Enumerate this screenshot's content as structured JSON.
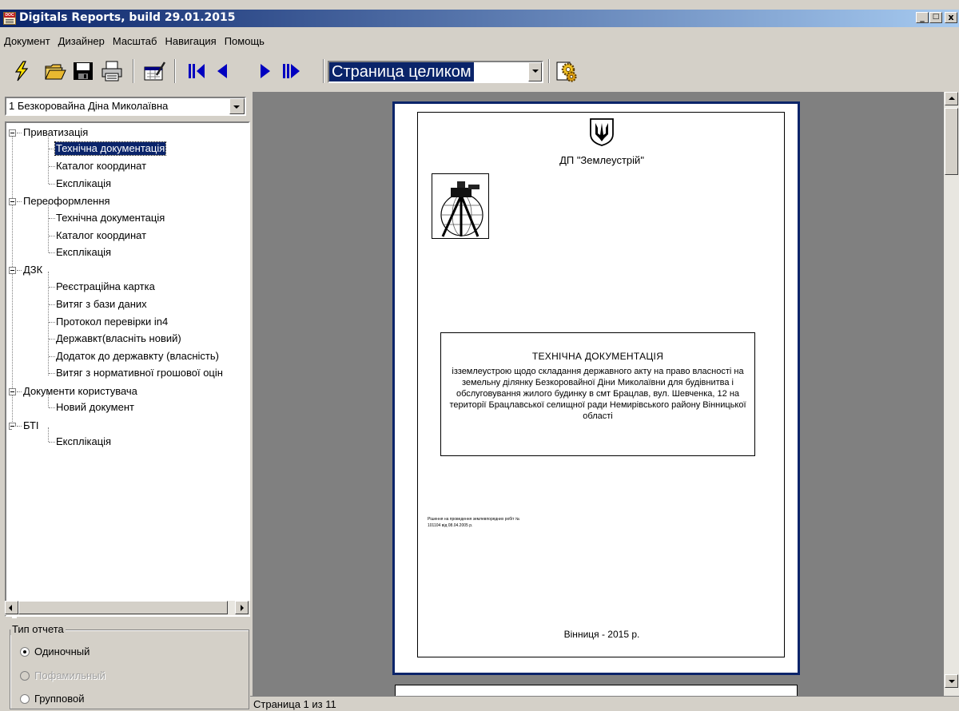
{
  "window": {
    "title": "Digitals Reports, build 29.01.2015",
    "minimize": "_",
    "maximize": "□",
    "close": "x"
  },
  "menu": [
    "Документ",
    "Дизайнер",
    "Масштаб",
    "Навигация",
    "Помощь"
  ],
  "toolbar": {
    "zoom_value": "Страница целиком"
  },
  "left": {
    "person_select": "1 Безкоровайна Діна Миколаївна",
    "tree": [
      {
        "label": "Приватизація",
        "children": [
          "Технічна документація",
          "Каталог координат",
          "Експлікація"
        ]
      },
      {
        "label": "Переоформлення",
        "children": [
          "Технічна документація",
          "Каталог координат",
          "Експлікація"
        ]
      },
      {
        "label": "ДЗК",
        "children": [
          "Реєстраційна картка",
          "Витяг з бази даних",
          "Протокол перевірки in4",
          "Державкт(власніть новий)",
          "Додаток до державкту (власність)",
          "Витяг з нормативної грошової оцін"
        ]
      },
      {
        "label": "Документи користувача",
        "children": [
          "Новий документ"
        ]
      },
      {
        "label": "БТІ",
        "children": [
          "Експлікація"
        ]
      }
    ],
    "selected": "Приватизація/Технічна документація",
    "report_type": {
      "legend": "Тип отчета",
      "options": [
        {
          "label": "Одиночный",
          "checked": true,
          "enabled": true
        },
        {
          "label": "Пофамильный",
          "checked": false,
          "enabled": false
        },
        {
          "label": "Групповой",
          "checked": false,
          "enabled": true
        }
      ]
    }
  },
  "document": {
    "org": "ДП \"Землеустрій\"",
    "title": "ТЕХНІЧНА ДОКУМЕНТАЦІЯ",
    "body": "ізземлеустрою щодо складання державного акту на право власності на земельну ділянку Безкоровайної Діни Миколаївни для будівнитва і обслуговування жилого будинку в смт Брацлав, вул. Шевченка, 12 на території Брацлавської селищної ради Немирівського району Вінницької області",
    "note": "Рішення на проведення землевпорядних робіт № 101104 від 08.04.2005 р.",
    "footer": "Вінниця - 2015 р."
  },
  "status": {
    "page_text": "Страница 1 из 11"
  }
}
